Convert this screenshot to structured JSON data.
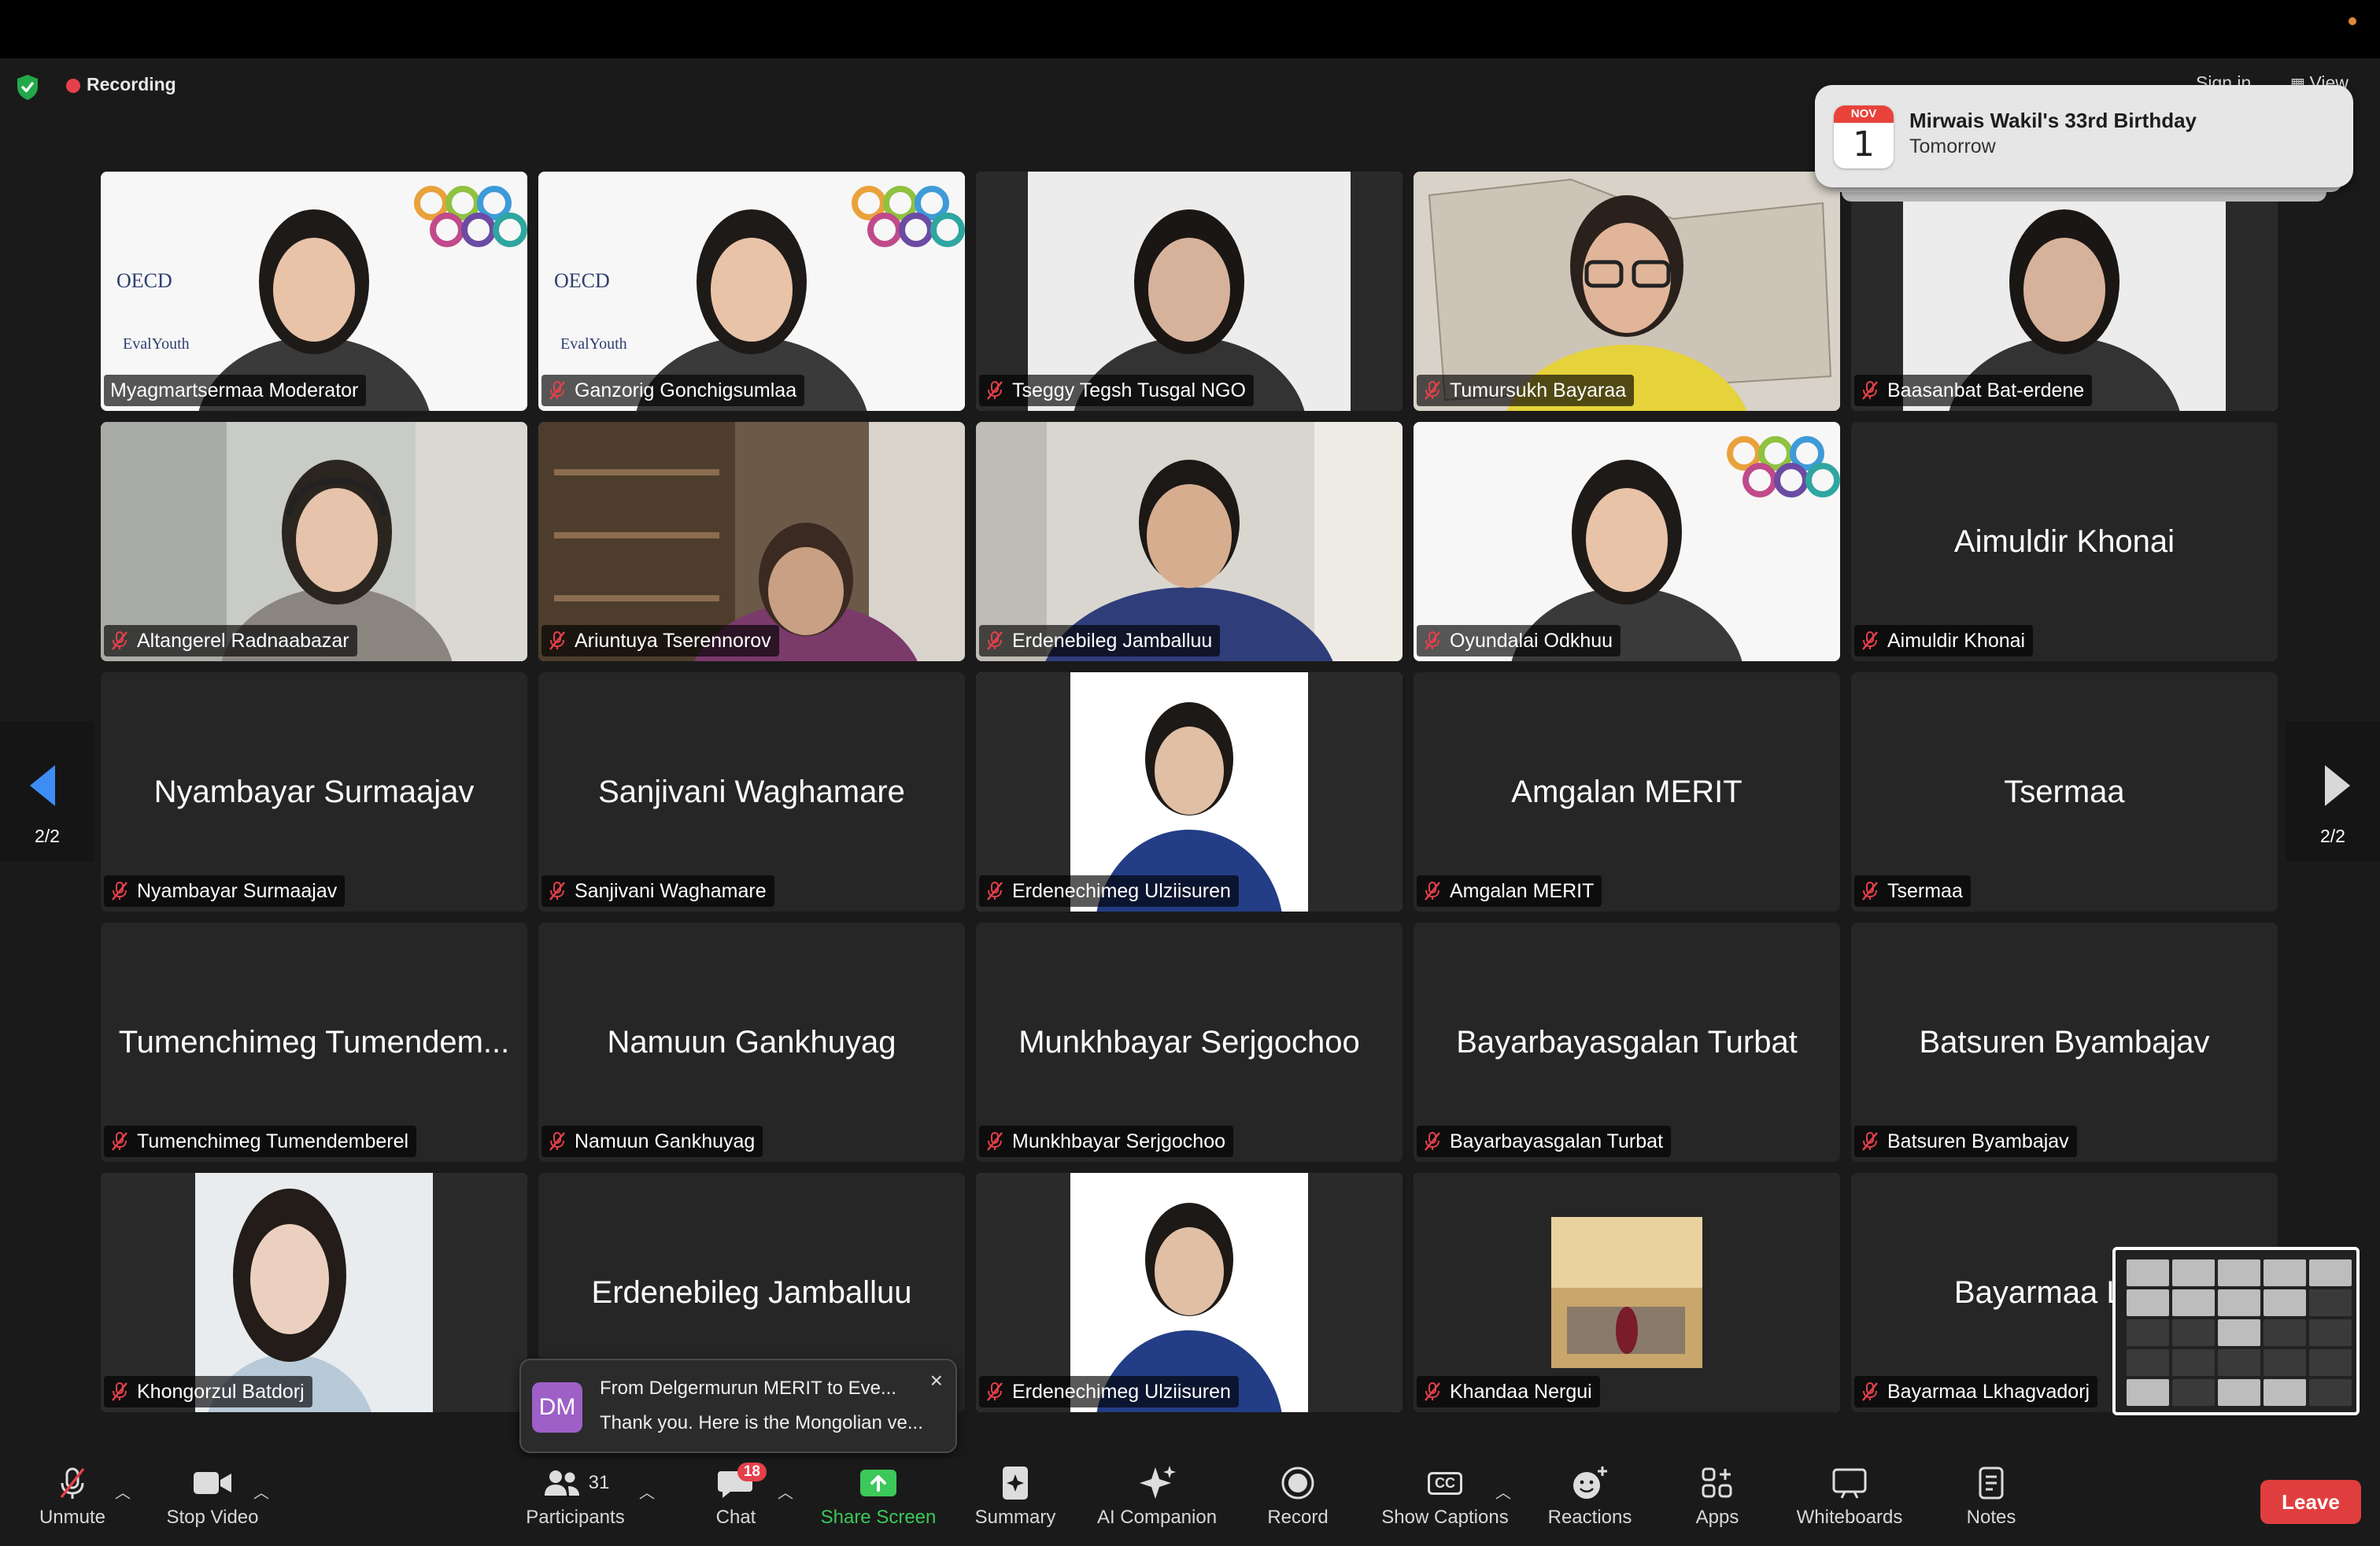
{
  "status": {
    "recording_label": "Recording",
    "sign_in_label": "Sign in",
    "view_label": "View"
  },
  "notification": {
    "month": "NOV",
    "day": "1",
    "title": "Mirwais Wakil's 33rd Birthday",
    "subtitle": "Tomorrow"
  },
  "pager": {
    "left": "2/2",
    "right": "2/2"
  },
  "tiles": [
    {
      "name": "Myagmartsermaa Moderator",
      "big": "",
      "video": true,
      "muted": false,
      "logo1": "OECD",
      "logo2": "EvalYouth",
      "scene": "bright"
    },
    {
      "name": "Ganzorig Gonchigsumlaa",
      "big": "",
      "video": true,
      "muted": true,
      "logo1": "OECD",
      "logo2": "EvalYouth",
      "scene": "bright"
    },
    {
      "name": "Tseggy Tegsh Tusgal NGO",
      "big": "",
      "video": true,
      "muted": true,
      "scene": "center"
    },
    {
      "name": "Tumursukh Bayaraa",
      "big": "",
      "video": true,
      "muted": true,
      "scene": "map"
    },
    {
      "name": "Baasanbat Bat-erdene",
      "big": "",
      "video": true,
      "muted": true,
      "scene": "center"
    },
    {
      "name": "Altangerel Radnaabazar",
      "big": "",
      "video": true,
      "muted": true,
      "scene": "office"
    },
    {
      "name": "Ariuntuya Tserennorov",
      "big": "",
      "video": true,
      "muted": true,
      "scene": "shelf"
    },
    {
      "name": "Erdenebileg Jamballuu",
      "big": "",
      "video": true,
      "muted": true,
      "scene": "room"
    },
    {
      "name": "Oyundalai Odkhuu",
      "big": "",
      "video": true,
      "muted": true,
      "scene": "bright"
    },
    {
      "name": "Aimuldir Khonai",
      "big": "Aimuldir Khonai",
      "video": false,
      "muted": true
    },
    {
      "name": "Nyambayar Surmaajav",
      "big": "Nyambayar Surmaajav",
      "video": false,
      "muted": true
    },
    {
      "name": "Sanjivani Waghamare",
      "big": "Sanjivani Waghamare",
      "video": false,
      "muted": true
    },
    {
      "name": "Erdenechimeg Ulziisuren",
      "big": "",
      "video": true,
      "muted": true,
      "scene": "portrait"
    },
    {
      "name": "Amgalan MERIT",
      "big": "Amgalan MERIT",
      "video": false,
      "muted": true
    },
    {
      "name": "Tsermaa",
      "big": "Tsermaa",
      "video": false,
      "muted": true
    },
    {
      "name": "Tumenchimeg Tumendemberel",
      "big": "Tumenchimeg Tumendem...",
      "video": false,
      "muted": true
    },
    {
      "name": "Namuun Gankhuyag",
      "big": "Namuun Gankhuyag",
      "video": false,
      "muted": true
    },
    {
      "name": "Munkhbayar Serjgochoo",
      "big": "Munkhbayar Serjgochoo",
      "video": false,
      "muted": true
    },
    {
      "name": "Bayarbayasgalan Turbat",
      "big": "Bayarbayasgalan Turbat",
      "video": false,
      "muted": true
    },
    {
      "name": "Batsuren Byambajav",
      "big": "Batsuren Byambajav",
      "video": false,
      "muted": true
    },
    {
      "name": "Khongorzul Batdorj",
      "big": "",
      "video": true,
      "muted": true,
      "scene": "girl"
    },
    {
      "name": "",
      "big": "Erdenebileg Jamballuu",
      "video": false,
      "muted": true
    },
    {
      "name": "Erdenechimeg Ulziisuren",
      "big": "",
      "video": true,
      "muted": true,
      "scene": "portrait"
    },
    {
      "name": "Khandaa Nergui",
      "big": "",
      "video": true,
      "muted": true,
      "scene": "photo"
    },
    {
      "name": "Bayarmaa Lkhagvadorj",
      "big": "Bayarmaa Lkha",
      "video": false,
      "muted": true
    }
  ],
  "chat_toast": {
    "avatar": "DM",
    "from": "From Delgermurun MERIT to Eve...",
    "message": "Thank you. Here is the Mongolian ve...",
    "close": "×"
  },
  "toolbar": {
    "unmute": "Unmute",
    "stop_video": "Stop Video",
    "participants": "Participants",
    "participants_count": "31",
    "chat": "Chat",
    "chat_badge": "18",
    "share_screen": "Share Screen",
    "summary": "Summary",
    "ai_companion": "AI Companion",
    "record": "Record",
    "show_captions": "Show Captions",
    "reactions": "Reactions",
    "apps": "Apps",
    "whiteboards": "Whiteboards",
    "notes": "Notes",
    "leave": "Leave",
    "cc": "CC"
  },
  "colors": {
    "leave": "#e03e3e",
    "share": "#3cc85a",
    "record_dot": "#e5404a",
    "badge": "#e5404a",
    "muted_icon": "#e5404a"
  }
}
